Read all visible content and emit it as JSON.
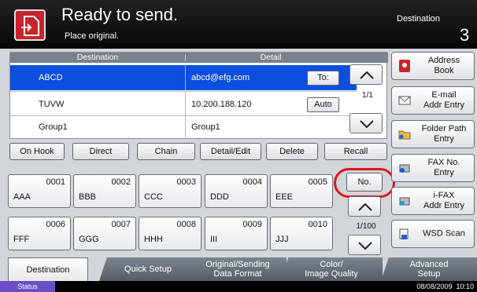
{
  "header": {
    "title": "Ready to send.",
    "subtitle": "Place original.",
    "destination_label": "Destination",
    "destination_count": "3"
  },
  "table": {
    "col_destination": "Destination",
    "col_detail": "Detail",
    "rows": [
      {
        "name": "ABCD",
        "detail": "abcd@efg.com",
        "button": "To:",
        "selected": true
      },
      {
        "name": "TUVW",
        "detail": "10.200.188.120",
        "button": "Auto",
        "selected": false
      },
      {
        "name": "Group1",
        "detail": "Group1",
        "button": "",
        "selected": false
      }
    ],
    "page": "1/1"
  },
  "function_buttons": [
    "On Hook",
    "Direct",
    "Chain",
    "Detail/Edit",
    "Delete",
    "Recall"
  ],
  "one_touch_keys": [
    {
      "number": "0001",
      "name": "AAA"
    },
    {
      "number": "0002",
      "name": "BBB"
    },
    {
      "number": "0003",
      "name": "CCC"
    },
    {
      "number": "0004",
      "name": "DDD"
    },
    {
      "number": "0005",
      "name": "EEE"
    },
    {
      "number": "0006",
      "name": "FFF"
    },
    {
      "number": "0007",
      "name": "GGG"
    },
    {
      "number": "0008",
      "name": "HHH"
    },
    {
      "number": "0009",
      "name": "III"
    },
    {
      "number": "0010",
      "name": "JJJ"
    }
  ],
  "number_button": "No.",
  "address_page": "1/100",
  "right_buttons": [
    {
      "label": "Address\nBook",
      "icon": "address-book-icon"
    },
    {
      "label": "E-mail\nAddr Entry",
      "icon": "email-icon"
    },
    {
      "label": "Folder Path\nEntry",
      "icon": "folder-icon"
    },
    {
      "label": "FAX No.\nEntry",
      "icon": "fax-icon"
    },
    {
      "label": "i-FAX\nAddr Entry",
      "icon": "ifax-icon"
    },
    {
      "label": "WSD Scan",
      "icon": "wsd-scan-icon"
    }
  ],
  "tabs": [
    "Destination",
    "Quick Setup",
    "Original/Sending\nData Format",
    "Color/\nImage Quality",
    "Advanced\nSetup"
  ],
  "status": {
    "label": "Status",
    "datetime": "08/08/2009  10:10"
  },
  "colors": {
    "selected_row": "#0b4fe0",
    "header_bg": "#0c0d0f",
    "highlight_ring": "#e0141c",
    "status_tag": "#6a4fc4"
  }
}
